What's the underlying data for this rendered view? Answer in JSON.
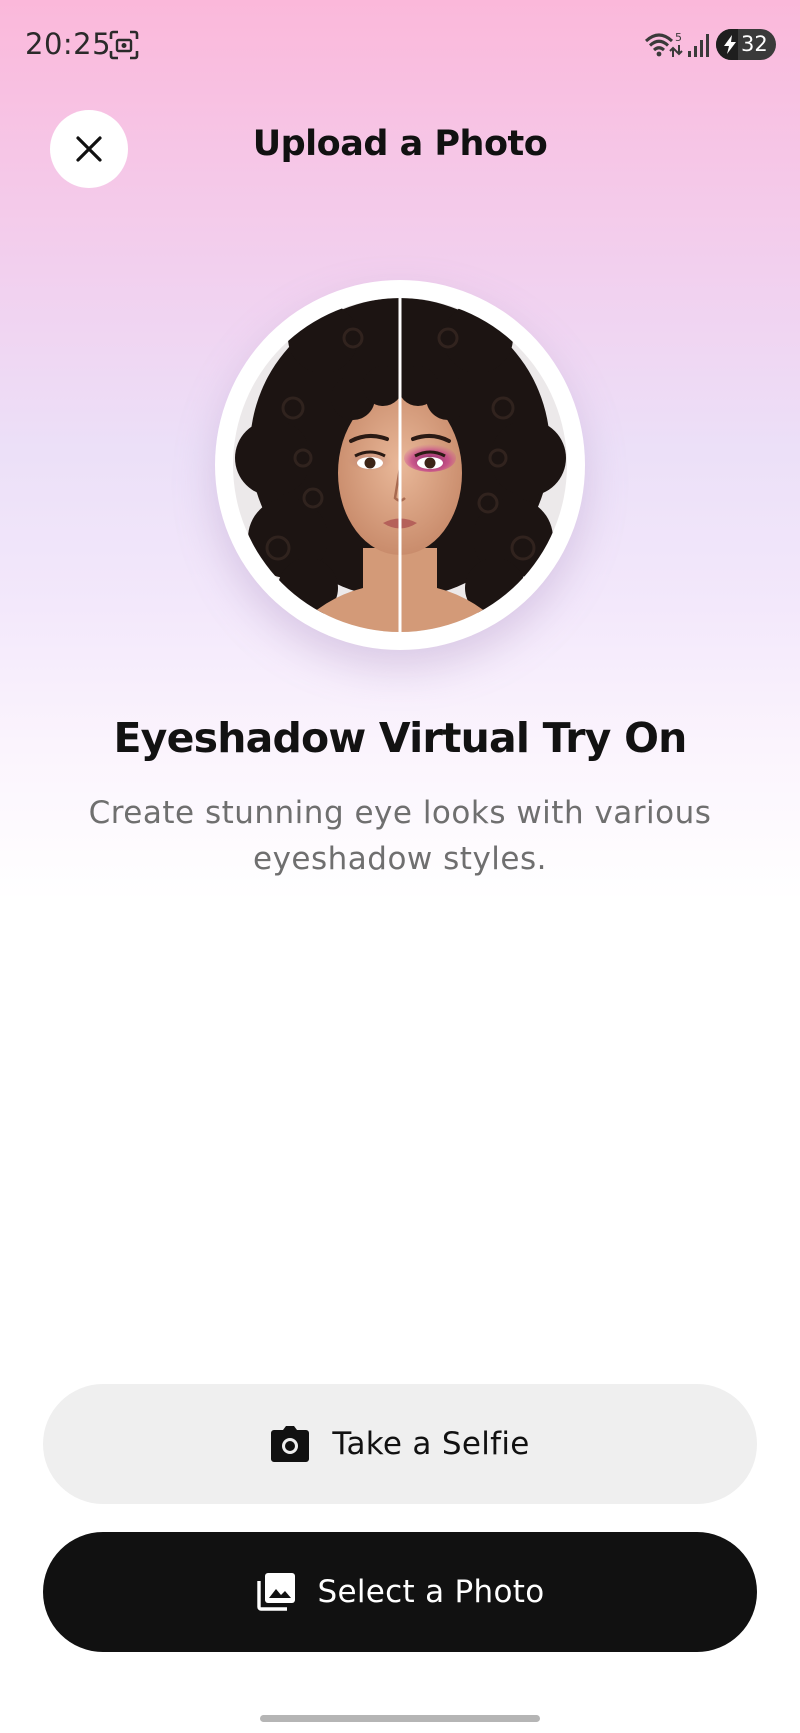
{
  "status_bar": {
    "time": "20:25",
    "battery_level": "32",
    "network_badge": "5",
    "icons": [
      "screenshot-icon",
      "wifi-icon",
      "signal-icon",
      "battery-charging-icon"
    ]
  },
  "header": {
    "title": "Upload a Photo",
    "close_icon": "close-icon"
  },
  "hero": {
    "image_description": "split before/after portrait",
    "accent_color": "#b0307a"
  },
  "feature": {
    "title": "Eyeshadow Virtual Try On",
    "description": "Create stunning eye looks with various eyeshadow styles."
  },
  "actions": {
    "take_selfie": {
      "label": "Take a Selfie",
      "icon": "camera-icon"
    },
    "select_photo": {
      "label": "Select a Photo",
      "icon": "photo-library-icon"
    }
  },
  "colors": {
    "gradient_top": "#fbb8da",
    "gradient_mid": "#ece0f8",
    "primary_button": "#111111",
    "secondary_button": "#efefef"
  }
}
